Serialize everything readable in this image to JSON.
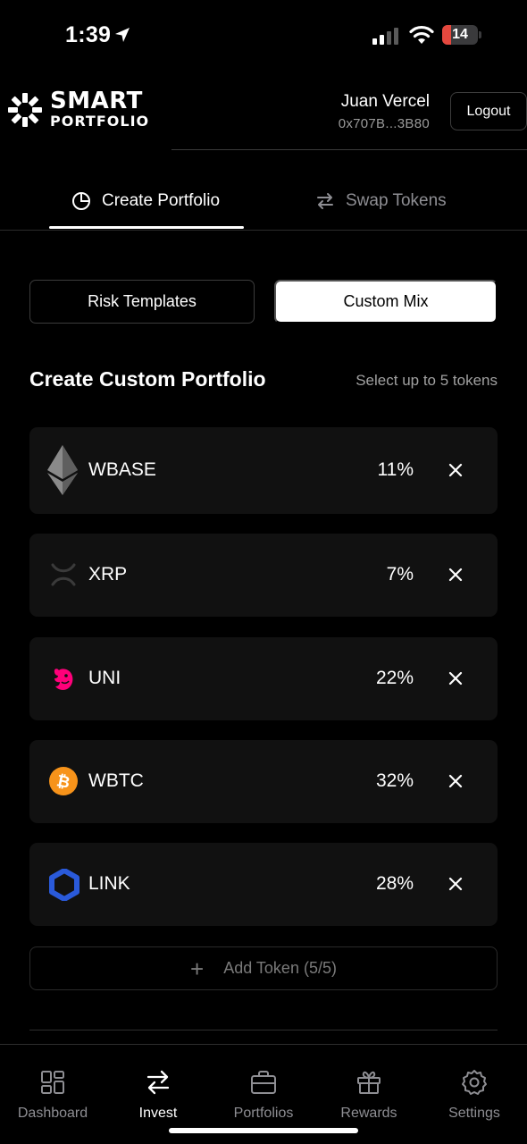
{
  "status_bar": {
    "time": "1:39",
    "battery": "14",
    "battery_level": 0.14,
    "battery_color": "#e5483e"
  },
  "header": {
    "logo_line1": "SMART",
    "logo_line2": "PORTFOLIO",
    "user_name": "Juan Vercel",
    "user_address": "0x707B...3B80",
    "logout_label": "Logout"
  },
  "tabs": [
    {
      "label": "Create Portfolio",
      "icon": "pie-chart-icon",
      "active": true
    },
    {
      "label": "Swap Tokens",
      "icon": "swap-arrows-icon",
      "active": false
    }
  ],
  "mode": {
    "risk_label": "Risk Templates",
    "custom_label": "Custom Mix",
    "selected": "Custom Mix"
  },
  "section": {
    "title": "Create Custom Portfolio",
    "hint": "Select up to 5 tokens"
  },
  "tokens": [
    {
      "name": "WBASE",
      "percent": "11%",
      "icon": "ethereum-icon"
    },
    {
      "name": "XRP",
      "percent": "7%",
      "icon": "xrp-icon"
    },
    {
      "name": "UNI",
      "percent": "22%",
      "icon": "uniswap-icon"
    },
    {
      "name": "WBTC",
      "percent": "32%",
      "icon": "bitcoin-icon"
    },
    {
      "name": "LINK",
      "percent": "28%",
      "icon": "chainlink-icon"
    }
  ],
  "add_token": {
    "label": "Add Token (5/5)"
  },
  "bottom_nav": [
    {
      "label": "Dashboard",
      "icon": "grid-icon",
      "active": false
    },
    {
      "label": "Invest",
      "icon": "swap-arrows-icon",
      "active": true
    },
    {
      "label": "Portfolios",
      "icon": "briefcase-icon",
      "active": false
    },
    {
      "label": "Rewards",
      "icon": "gift-icon",
      "active": false
    },
    {
      "label": "Settings",
      "icon": "gear-icon",
      "active": false
    }
  ],
  "colors": {
    "background": "#000000",
    "card": "#111111",
    "uni_pink": "#ff007a",
    "btc_orange": "#f7931a",
    "link_blue": "#2a5ada"
  }
}
